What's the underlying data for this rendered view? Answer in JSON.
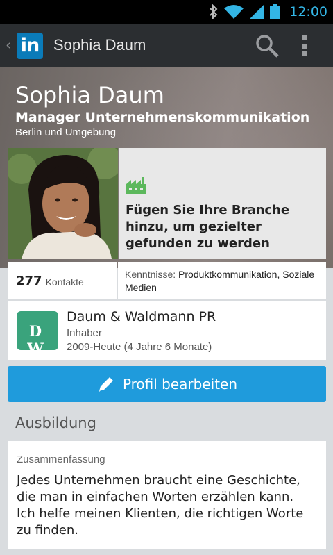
{
  "status_bar": {
    "time": "12:00",
    "icons": [
      "bluetooth-icon",
      "wifi-icon",
      "signal-icon",
      "battery-icon"
    ],
    "accent_color": "#33b5e5"
  },
  "action_bar": {
    "logo_text": "in",
    "title": "Sophia Daum",
    "icons": [
      "up-caret-icon",
      "search-icon",
      "overflow-menu-icon"
    ]
  },
  "profile": {
    "name": "Sophia Daum",
    "headline": "Manager Unternehmenskommunikation",
    "location": "Berlin und Umgebung"
  },
  "industry_card": {
    "icon": "factory-icon",
    "text": "Fügen Sie Ihre Branche hinzu, um gezielter gefunden zu werden",
    "icon_color": "#5cb85c"
  },
  "stats": {
    "connections_count": "277",
    "connections_label": "Kontakte",
    "skills_label": "Kenntnisse:",
    "skills_value": " Produktkommunikation, Soziale Medien"
  },
  "position": {
    "logo_text": "D W",
    "company": "Daum & Waldmann PR",
    "title": "Inhaber",
    "dates": "2009-Heute (4 Jahre 6 Monate)"
  },
  "edit_button": {
    "label": "Profil bearbeiten",
    "color": "#1f9bdc"
  },
  "education": {
    "title": "Ausbildung"
  },
  "summary": {
    "label": "Zusammenfassung",
    "text": "Jedes Unternehmen braucht eine Geschichte, die man in einfachen Worten erzählen kann. Ich helfe meinen Klienten, die richtigen Worte zu finden."
  }
}
